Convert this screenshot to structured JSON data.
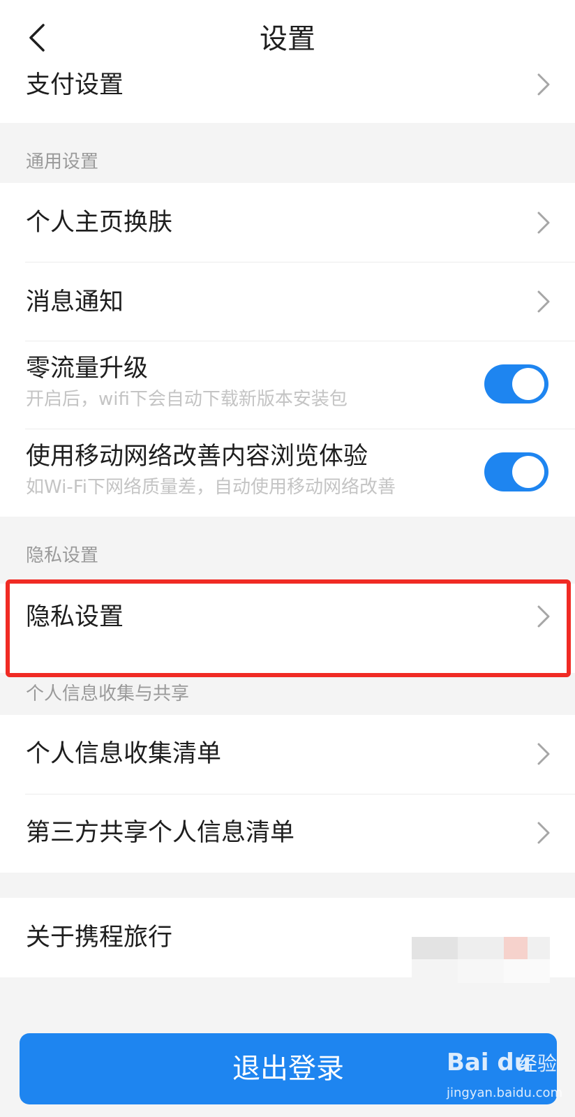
{
  "header": {
    "title": "设置"
  },
  "payment": {
    "label": "支付设置"
  },
  "general": {
    "section_label": "通用设置",
    "skin": {
      "label": "个人主页换肤"
    },
    "notify": {
      "label": "消息通知"
    },
    "zero_data": {
      "label": "零流量升级",
      "desc": "开启后，wifi下会自动下载新版本安装包",
      "enabled": true
    },
    "mobile_net": {
      "label": "使用移动网络改善内容浏览体验",
      "desc": "如Wi-Fi下网络质量差，自动使用移动网络改善",
      "enabled": true
    }
  },
  "privacy": {
    "section_label": "隐私设置",
    "item": {
      "label": "隐私设置"
    }
  },
  "personal_info": {
    "section_label": "个人信息收集与共享",
    "collect": {
      "label": "个人信息收集清单"
    },
    "third_party": {
      "label": "第三方共享个人信息清单"
    }
  },
  "about": {
    "label": "关于携程旅行"
  },
  "logout": {
    "label": "退出登录"
  },
  "watermark": {
    "logo": "Bai du",
    "jingyan": "经验",
    "url": "jingyan.baidu.com"
  },
  "colors": {
    "accent": "#1e85f0",
    "highlight": "#f02b24",
    "background": "#f4f4f4"
  },
  "icons": {
    "back": "chevron-left-icon",
    "row": "chevron-right-icon"
  }
}
